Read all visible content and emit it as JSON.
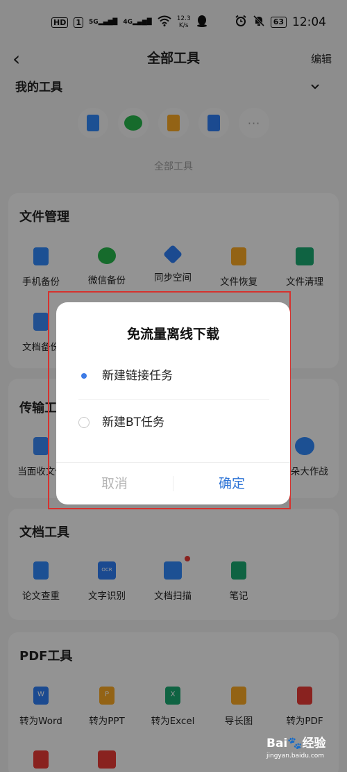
{
  "status_bar": {
    "hd": "HD",
    "sim": "1",
    "net1": "5G",
    "net2": "4G",
    "speed_value": "12.3",
    "speed_unit": "K/s",
    "battery": "63",
    "time": "12:04"
  },
  "header": {
    "back_icon": "‹",
    "title": "全部工具",
    "edit_label": "编辑"
  },
  "my_tools": {
    "title": "我的工具",
    "chevron": "⌄",
    "icons": [
      "phone-backup-icon",
      "wechat-icon",
      "file-restore-icon",
      "document-icon",
      "more-icon"
    ],
    "more": "···"
  },
  "all_tools_label": "全部工具",
  "sections": [
    {
      "title": "文件管理",
      "tools": [
        {
          "label": "手机备份",
          "icon": "phone-backup-icon",
          "color": "#2f86f6"
        },
        {
          "label": "微信备份",
          "icon": "wechat-icon",
          "color": "#25b34a"
        },
        {
          "label": "同步空间",
          "icon": "sync-space-icon",
          "color": "#2d7cf0"
        },
        {
          "label": "文件恢复",
          "icon": "file-restore-icon",
          "color": "#f5a623"
        },
        {
          "label": "文件清理",
          "icon": "trash-clean-icon",
          "color": "#1aa56f"
        },
        {
          "label": "文档备份",
          "icon": "doc-backup-icon",
          "color": "#3a86f0"
        }
      ]
    },
    {
      "title": "传输工具",
      "tools": [
        {
          "label": "当面收文件",
          "icon": "receive-file-icon",
          "color": "#3a86f0"
        },
        {
          "label": "花朵大作战",
          "icon": "cloud-game-icon",
          "color": "#2f86f6"
        }
      ]
    },
    {
      "title": "文档工具",
      "tools": [
        {
          "label": "论文查重",
          "icon": "paper-check-icon",
          "color": "#2f86f6"
        },
        {
          "label": "文字识别",
          "icon": "ocr-icon",
          "color": "#2d7cf0",
          "glyph": "OCR"
        },
        {
          "label": "文档扫描",
          "icon": "doc-scan-icon",
          "color": "#2f86f6",
          "badge": true
        },
        {
          "label": "笔记",
          "icon": "notes-icon",
          "color": "#1aa56f"
        }
      ]
    },
    {
      "title": "PDF工具",
      "tools": [
        {
          "label": "转为Word",
          "icon": "word-icon",
          "color": "#2d7cf0",
          "glyph": "W"
        },
        {
          "label": "转为PPT",
          "icon": "ppt-icon",
          "color": "#f5a623",
          "glyph": "P"
        },
        {
          "label": "转为Excel",
          "icon": "excel-icon",
          "color": "#1aa56f",
          "glyph": "X"
        },
        {
          "label": "导长图",
          "icon": "long-image-icon",
          "color": "#f5a623"
        },
        {
          "label": "转为PDF",
          "icon": "pdf-icon",
          "color": "#e53935"
        }
      ]
    }
  ],
  "dialog": {
    "title": "免流量离线下载",
    "options": [
      {
        "label": "新建链接任务",
        "selected": true
      },
      {
        "label": "新建BT任务",
        "selected": false
      }
    ],
    "cancel_label": "取消",
    "confirm_label": "确定"
  },
  "watermark": {
    "brand": "Bai",
    "brand_suffix": "经验",
    "url": "jingyan.baidu.com"
  }
}
